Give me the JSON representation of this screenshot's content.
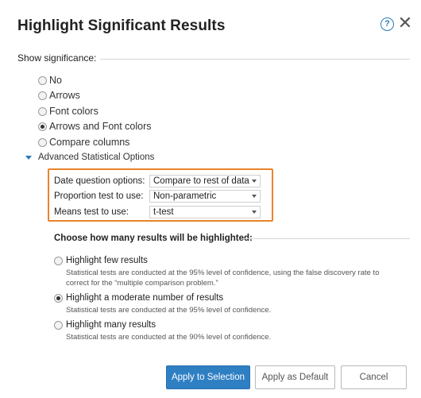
{
  "dialog": {
    "title": "Highlight Significant Results",
    "help_glyph": "?",
    "close_glyph": "✕"
  },
  "significance": {
    "label": "Show significance:",
    "options": [
      {
        "label": "No",
        "checked": false
      },
      {
        "label": "Arrows",
        "checked": false
      },
      {
        "label": "Font colors",
        "checked": false
      },
      {
        "label": "Arrows and Font colors",
        "checked": true
      },
      {
        "label": "Compare columns",
        "checked": false
      }
    ]
  },
  "advanced": {
    "toggle_label": "Advanced Statistical Options",
    "date_label": "Date question options:",
    "date_value": "Compare to rest of data",
    "proportion_label": "Proportion test to use:",
    "proportion_value": "Non-parametric",
    "means_label": "Means test to use:",
    "means_value": "t-test"
  },
  "highlight": {
    "label": "Choose how many results will be highlighted:",
    "options": [
      {
        "title": "Highlight few results",
        "desc": "Statistical tests are conducted at the 95% level of confidence, using the false discovery rate to correct for the “multiple comparison problem.”",
        "checked": false
      },
      {
        "title": "Highlight a moderate number of results",
        "desc": "Statistical tests are conducted at the 95% level of confidence.",
        "checked": true
      },
      {
        "title": "Highlight many results",
        "desc": "Statistical tests are conducted at the 90% level of confidence.",
        "checked": false
      }
    ]
  },
  "buttons": {
    "apply_selection": "Apply to Selection",
    "apply_default": "Apply as Default",
    "cancel": "Cancel"
  },
  "colors": {
    "accent": "#2f7fc3",
    "highlight_border": "#e8842b"
  }
}
